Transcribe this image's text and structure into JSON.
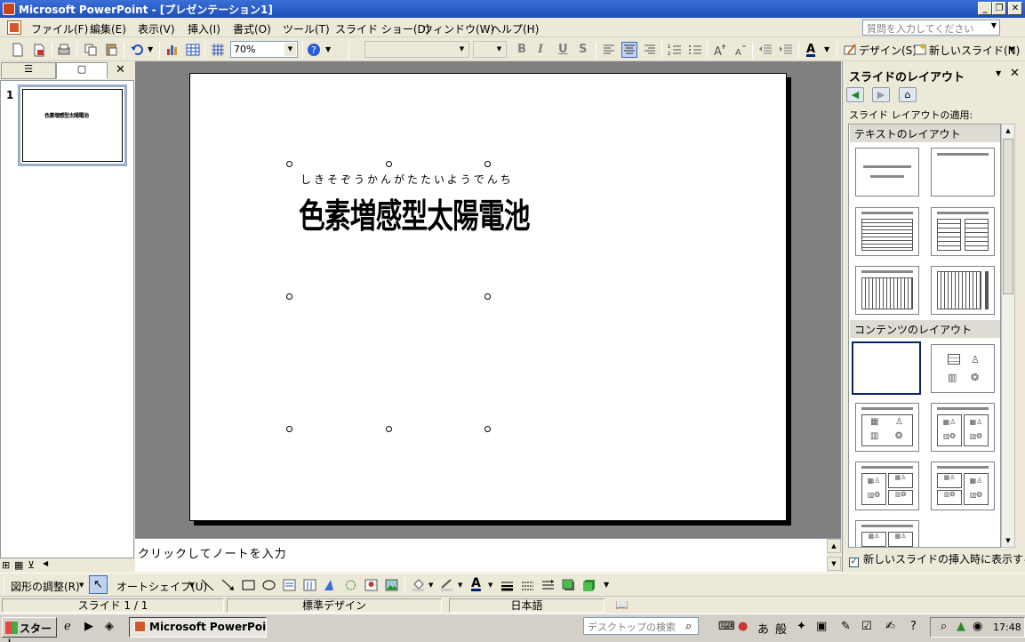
{
  "window": {
    "title": "Microsoft PowerPoint - [プレゼンテーション1]",
    "min_label": "_",
    "restore_label": "❐",
    "close_label": "✕"
  },
  "menu": {
    "items": [
      "ファイル(F)",
      "編集(E)",
      "表示(V)",
      "挿入(I)",
      "書式(O)",
      "ツール(T)",
      "スライド ショー(D)",
      "ウィンドウ(W)",
      "ヘルプ(H)"
    ],
    "ask_placeholder": "質問を入力してください"
  },
  "toolbar": {
    "zoom": "70%",
    "design_label": "デザイン(S)",
    "new_slide_label": "新しいスライド(N)",
    "bold": "B",
    "italic": "I",
    "underline": "U",
    "shadow": "S",
    "font_color": "A"
  },
  "left_pane": {
    "slide_number": "1",
    "thumb_title": "色素増感型太陽電池"
  },
  "slide": {
    "ruby": "しきそぞうかんがたたいようでんち",
    "title": "色素増感型太陽電池"
  },
  "notes": {
    "placeholder": "クリックしてノートを入力"
  },
  "task_pane": {
    "title": "スライドのレイアウト",
    "apply_label": "スライド レイアウトの適用:",
    "text_group": "テキストのレイアウト",
    "content_group": "コンテンツのレイアウト",
    "show_on_insert": "新しいスライドの挿入時に表示する"
  },
  "drawing_toolbar": {
    "adjust_label": "図形の調整(R)",
    "autoshape_label": "オートシェイプ(U)"
  },
  "status": {
    "slide": "スライド 1 / 1",
    "design": "標準デザイン",
    "language": "日本語"
  },
  "taskbar": {
    "start": "スタート",
    "app": "Microsoft PowerPoi...",
    "search_placeholder": "デスクトップの検索",
    "ime_a": "あ",
    "ime_han": "般",
    "time": "17:48"
  }
}
